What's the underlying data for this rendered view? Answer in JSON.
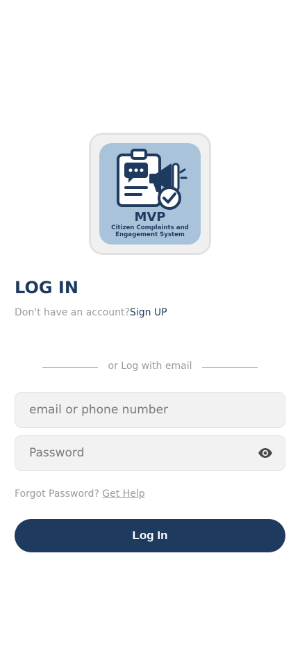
{
  "logo": {
    "title": "MVP",
    "subtitle_line1": "Citizen Complaints and",
    "subtitle_line2": "Engagement System"
  },
  "page": {
    "heading": "LOG IN",
    "no_account_text": "Don't have an account?",
    "signup_link": "Sign UP",
    "divider_text": "or Log with email"
  },
  "form": {
    "email_placeholder": "email or phone number",
    "email_value": "",
    "password_placeholder": "Password",
    "password_value": "",
    "password_toggle_icon": "eye-icon"
  },
  "help": {
    "forgot_text": "Forgot Password?",
    "help_link": "Get Help"
  },
  "actions": {
    "login_label": "Log In"
  },
  "colors": {
    "primary": "#1e3a5f",
    "logo_background": "#a9c4da",
    "muted_text": "#9a9a9a",
    "field_background": "#f2f2f2"
  }
}
